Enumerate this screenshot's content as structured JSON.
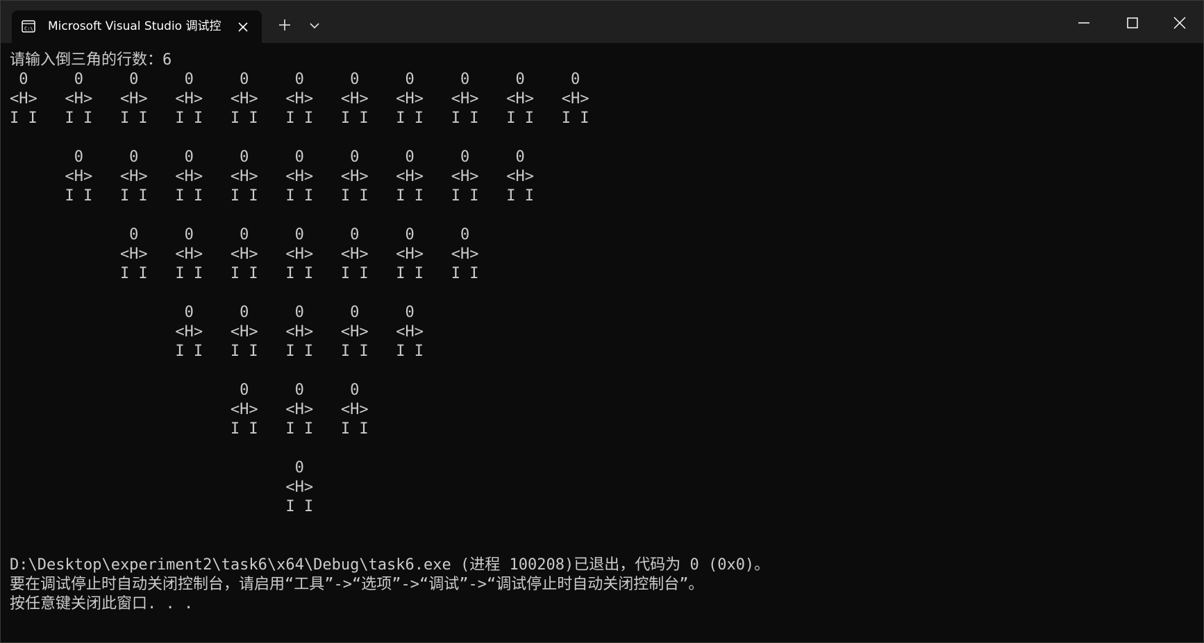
{
  "window": {
    "tab_title": "Microsoft Visual Studio 调试控",
    "tab_icon": "console-icon",
    "close_tab_icon": "close-icon",
    "new_tab_icon": "plus-icon",
    "dropdown_icon": "chevron-down-icon",
    "minimize_icon": "minimize-icon",
    "maximize_icon": "maximize-icon",
    "close_window_icon": "close-icon"
  },
  "colors": {
    "titlebar": "#202020",
    "console_background": "#0c0c0c",
    "console_text": "#cccccc",
    "tab_text": "#ffffff"
  },
  "console": {
    "text": "请输入倒三角的行数：6\n 0     0     0     0     0     0     0     0     0     0     0\n<H>   <H>   <H>   <H>   <H>   <H>   <H>   <H>   <H>   <H>   <H>\nI I   I I   I I   I I   I I   I I   I I   I I   I I   I I   I I\n\n       0     0     0     0     0     0     0     0     0\n      <H>   <H>   <H>   <H>   <H>   <H>   <H>   <H>   <H>\n      I I   I I   I I   I I   I I   I I   I I   I I   I I\n\n             0     0     0     0     0     0     0\n            <H>   <H>   <H>   <H>   <H>   <H>   <H>\n            I I   I I   I I   I I   I I   I I   I I\n\n                   0     0     0     0     0\n                  <H>   <H>   <H>   <H>   <H>\n                  I I   I I   I I   I I   I I\n\n                         0     0     0\n                        <H>   <H>   <H>\n                        I I   I I   I I\n\n                               0\n                              <H>\n                              I I\n\n\nD:\\Desktop\\experiment2\\task6\\x64\\Debug\\task6.exe (进程 100208)已退出，代码为 0 (0x0)。\n要在调试停止时自动关闭控制台，请启用“工具”->“选项”->“调试”->“调试停止时自动关闭控制台”。\n按任意键关闭此窗口. . ."
  }
}
